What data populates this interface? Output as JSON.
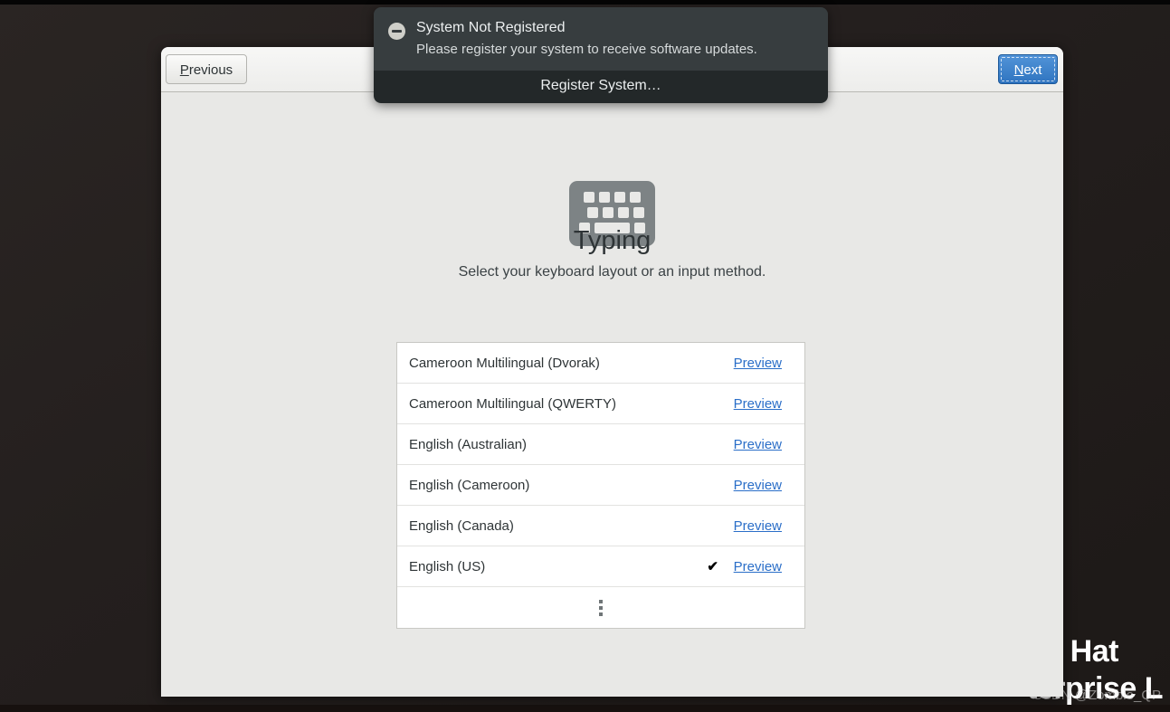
{
  "notification": {
    "icon": "minus-circle-icon",
    "title": "System Not Registered",
    "description": "Please register your system to receive software updates.",
    "action_label": "Register System…"
  },
  "window": {
    "toolbar": {
      "previous_label": "Previous",
      "previous_mnemonic": "P",
      "next_label": "Next",
      "next_mnemonic": "N"
    },
    "page": {
      "icon": "keyboard-icon",
      "title": "Typing",
      "subtitle": "Select your keyboard layout or an input method.",
      "more_indicator": "vertical-ellipsis-icon"
    },
    "layouts": [
      {
        "label": "Cameroon Multilingual (Dvorak)",
        "selected": false,
        "preview_label": "Preview"
      },
      {
        "label": "Cameroon Multilingual (QWERTY)",
        "selected": false,
        "preview_label": "Preview"
      },
      {
        "label": "English (Australian)",
        "selected": false,
        "preview_label": "Preview"
      },
      {
        "label": "English (Cameroon)",
        "selected": false,
        "preview_label": "Preview"
      },
      {
        "label": "English (Canada)",
        "selected": false,
        "preview_label": "Preview"
      },
      {
        "label": "English (US)",
        "selected": true,
        "check_glyph": "✔",
        "preview_label": "Preview"
      }
    ]
  },
  "desktop": {
    "brand_line1": "ed Hat",
    "brand_line2": "terprise L",
    "watermark": "CSDN @Zombie_QP"
  },
  "colors": {
    "accent_blue": "#2f74c0",
    "link_blue": "#2a6ec8",
    "window_bg": "#e8e8e6",
    "list_bg": "#ffffff",
    "notif_bg": "#373d3f",
    "notif_action_bg": "#232829",
    "icon_gray": "#7d8385",
    "desktop_bg": "#241f1e"
  }
}
